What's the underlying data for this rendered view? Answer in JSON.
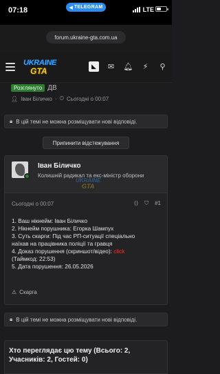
{
  "status_bar": {
    "time": "07:18",
    "back_app_label": "TELEGRAM",
    "network": "LTE",
    "battery_fraction": 0.45
  },
  "browser": {
    "url": "forum.ukraine-gta.com.ua"
  },
  "header": {
    "logo_line1": "UKRAINE",
    "logo_line2": "GTA",
    "icons": [
      "menu-icon",
      "user-avatar-icon",
      "inbox-icon",
      "bell-icon",
      "bolt-icon",
      "search-icon"
    ]
  },
  "thread": {
    "prefix_label": "Розглянуто",
    "title_fragment": "ДВ",
    "starter": "Іван Біличко",
    "started": "Сьогодні о 00:07"
  },
  "notices": {
    "locked_text": "В цій темі не можна розміщувати нові відповіді."
  },
  "actions": {
    "unwatch_label": "Припинити відстежування"
  },
  "post": {
    "author": "Іван Біличко",
    "user_title": "Колишній радикал та екс-міністр оборони",
    "watermark_line1": "UKRAINE",
    "watermark_line2": "GTA",
    "date": "Сьогодні о 00:07",
    "number": "#1",
    "lines": [
      "1. Ваш нікнейм: Іван Біличко",
      "2. Нікнейм порушника: Егорка Шампух",
      "3. Суть скарги: Під час РП-ситуації спеціально",
      "наїхав на працівника поліції та гравця",
      "4. Доказ порушення (скриншот/відео): ",
      "(Таймкод: 22:53)",
      "5. Дата порушення: 26.05.2026"
    ],
    "proof_link_label": "click",
    "report_label": "Скарга"
  },
  "who_viewing": {
    "title": "Хто переглядає цю тему (Всього: 2, Учасників: 2, Гостей: 0)"
  },
  "colors": {
    "background": "#1c1c1e",
    "prefix_green": "#2e7d32",
    "link_red": "#e53935",
    "telegram_blue": "#2d8cf0"
  }
}
